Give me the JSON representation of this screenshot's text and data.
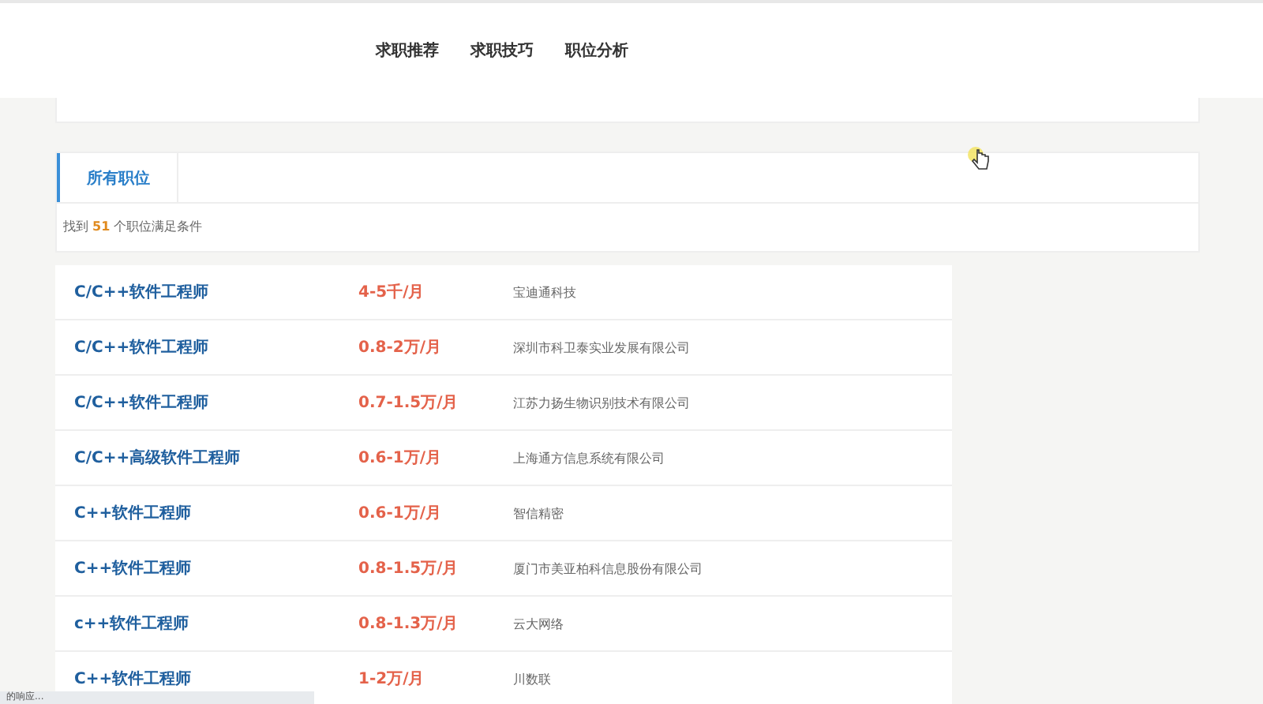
{
  "nav": {
    "items": [
      {
        "label": "求职推荐"
      },
      {
        "label": "求职技巧"
      },
      {
        "label": "职位分析"
      }
    ]
  },
  "tabs": [
    {
      "label": "所有职位",
      "selected": true
    }
  ],
  "result_summary": "找到 **51** 个职位满足条件",
  "jobs": [
    {
      "title": "C/C++软件工程师",
      "salary": "4-5千/月",
      "company": "宝迪通科技"
    },
    {
      "title": "C/C++软件工程师",
      "salary": "0.8-2万/月",
      "company": "深圳市科卫泰实业发展有限公司"
    },
    {
      "title": "C/C++软件工程师",
      "salary": "0.7-1.5万/月",
      "company": "江苏力扬生物识别技术有限公司"
    },
    {
      "title": "C/C++高级软件工程师",
      "salary": "0.6-1万/月",
      "company": "上海通方信息系统有限公司"
    },
    {
      "title": "C++软件工程师",
      "salary": "0.6-1万/月",
      "company": "智信精密"
    },
    {
      "title": "C++软件工程师",
      "salary": "0.8-1.5万/月",
      "company": "厦门市美亚柏科信息股份有限公司"
    },
    {
      "title": "c++软件工程师",
      "salary": "0.8-1.3万/月",
      "company": "云大网络"
    },
    {
      "title": "C++软件工程师",
      "salary": "1-2万/月",
      "company": "川数联"
    }
  ],
  "status_text": "的响应..."
}
